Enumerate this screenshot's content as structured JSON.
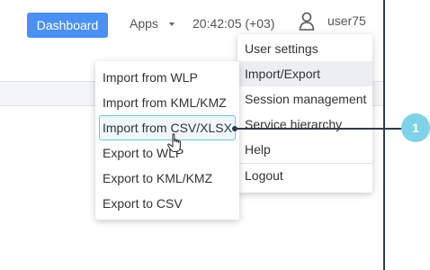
{
  "topbar": {
    "dashboard_label": "Dashboard",
    "apps_label": "Apps",
    "clock": "20:42:05 (+03)",
    "username": "user75"
  },
  "user_menu": {
    "items": [
      {
        "label": "User settings"
      },
      {
        "label": "Import/Export"
      },
      {
        "label": "Session management"
      },
      {
        "label": "Service hierarchy"
      },
      {
        "label": "Help"
      },
      {
        "label": "Logout"
      }
    ]
  },
  "import_menu": {
    "items": [
      {
        "label": "Import from WLP"
      },
      {
        "label": "Import from KML/KMZ"
      },
      {
        "label": "Import from CSV/XLSX"
      },
      {
        "label": "Export to WLP"
      },
      {
        "label": "Export to KML/KMZ"
      },
      {
        "label": "Export to CSV"
      }
    ]
  },
  "callout": {
    "number": "1"
  },
  "colors": {
    "accent": "#4a90f5",
    "callout": "#7fd3e8",
    "frame": "#2f3b4c",
    "selected_border": "#6fc6e0"
  },
  "icons": [
    "user-icon",
    "hand-pointer-icon",
    "caret-down-icon"
  ]
}
